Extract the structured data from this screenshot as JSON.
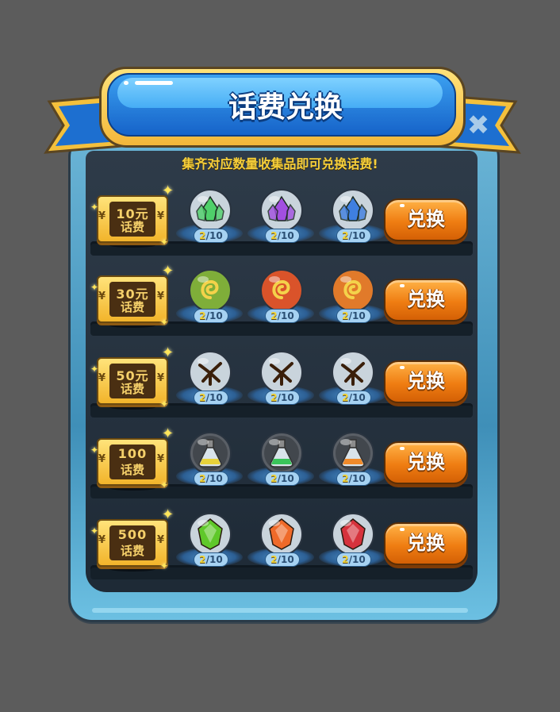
{
  "title": "话费兑换",
  "subtitle": "集齐对应数量收集品即可兑换话费!",
  "close_icon": "close-icon",
  "colors": {
    "background": "#5c5c5c",
    "banner_blue": "#1663c9",
    "subtitle_gold": "#f6cf3a",
    "button_orange": "#ef7d12"
  },
  "rows": [
    {
      "amount": "10元",
      "label": "话费",
      "button": "兑换",
      "items": [
        {
          "icon": "green-crystal-icon",
          "have": "2",
          "need": "/10",
          "color": "#4fd06a"
        },
        {
          "icon": "purple-crystal-icon",
          "have": "2",
          "need": "/10",
          "color": "#a24fe0"
        },
        {
          "icon": "blue-crystal-icon",
          "have": "2",
          "need": "/10",
          "color": "#3f7fe0"
        }
      ]
    },
    {
      "amount": "30元",
      "label": "话费",
      "button": "兑换",
      "items": [
        {
          "icon": "green-swirl-icon",
          "have": "2",
          "need": "/10",
          "color": "#7fae3a"
        },
        {
          "icon": "red-swirl-icon",
          "have": "2",
          "need": "/10",
          "color": "#d9542a"
        },
        {
          "icon": "orange-swirl-icon",
          "have": "2",
          "need": "/10",
          "color": "#e07a2a"
        }
      ]
    },
    {
      "amount": "50元",
      "label": "话费",
      "button": "兑换",
      "items": [
        {
          "icon": "fire-rune-icon",
          "have": "2",
          "need": "/10",
          "color": "#f09a1c"
        },
        {
          "icon": "green-rune-icon",
          "have": "2",
          "need": "/10",
          "color": "#4e8a2e"
        },
        {
          "icon": "brown-rune-icon",
          "have": "2",
          "need": "/10",
          "color": "#8a4a1e"
        }
      ]
    },
    {
      "amount": "100",
      "label": "话费",
      "button": "兑换",
      "items": [
        {
          "icon": "yellow-potion-icon",
          "have": "2",
          "need": "/10",
          "color": "#e8d23a"
        },
        {
          "icon": "green-potion-icon",
          "have": "2",
          "need": "/10",
          "color": "#3ac45a"
        },
        {
          "icon": "orange-potion-icon",
          "have": "2",
          "need": "/10",
          "color": "#f08a2a"
        }
      ]
    },
    {
      "amount": "500",
      "label": "话费",
      "button": "兑换",
      "items": [
        {
          "icon": "green-gem-icon",
          "have": "2",
          "need": "/10",
          "color": "#5fc82a"
        },
        {
          "icon": "orange-gem-icon",
          "have": "2",
          "need": "/10",
          "color": "#ef6a2a"
        },
        {
          "icon": "red-gem-icon",
          "have": "2",
          "need": "/10",
          "color": "#d6323c"
        }
      ]
    }
  ]
}
